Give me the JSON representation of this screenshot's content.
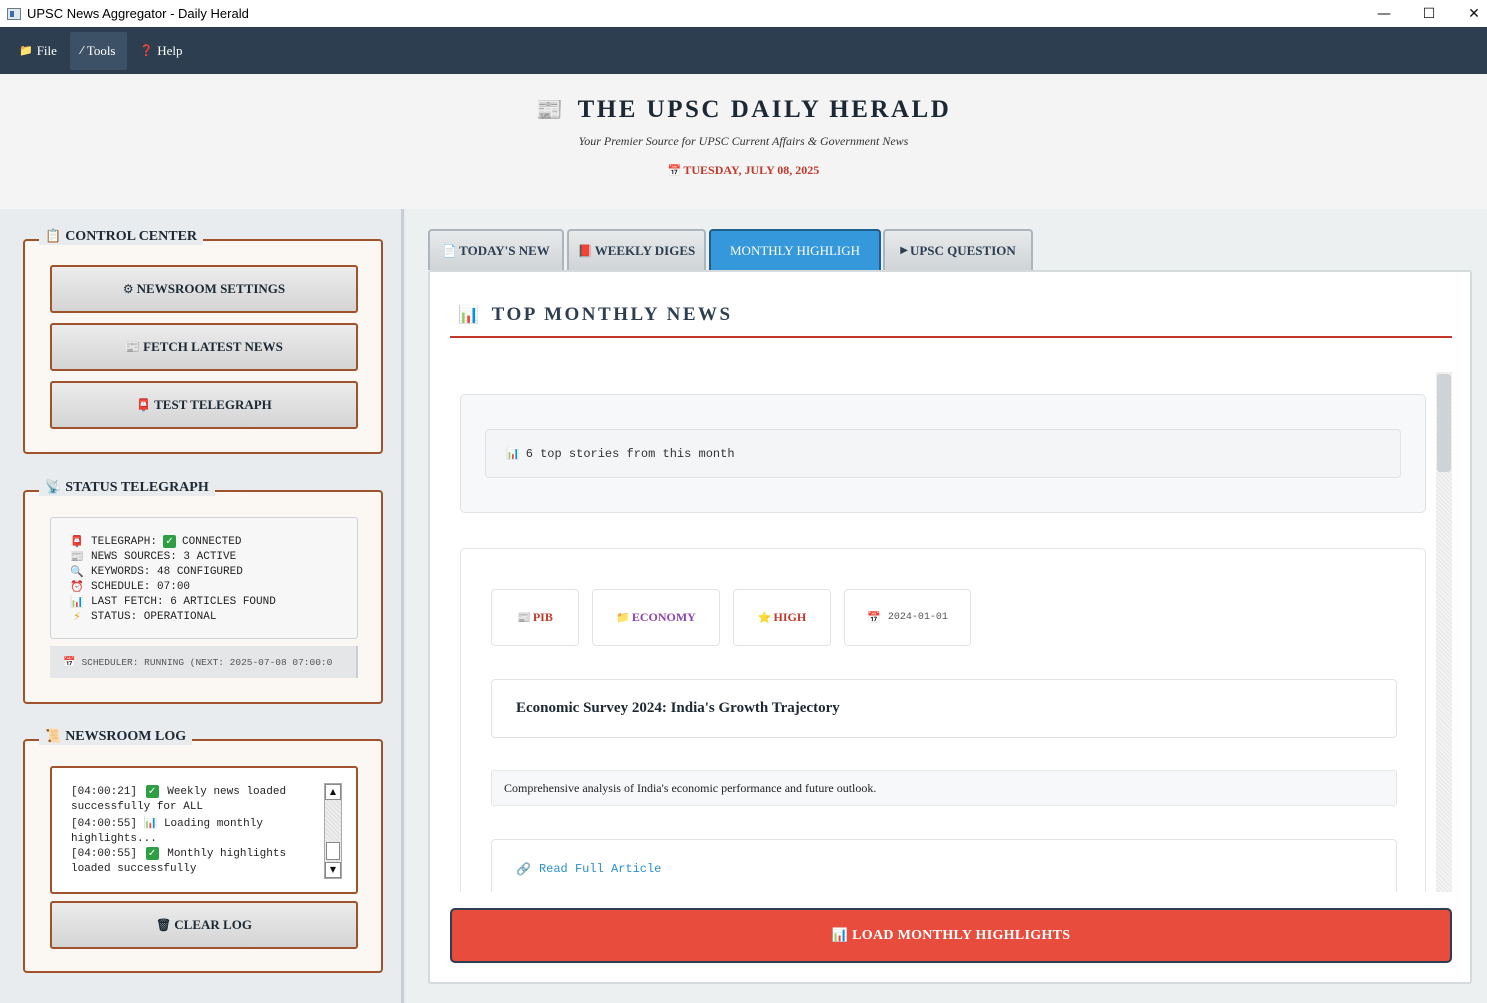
{
  "window": {
    "title": "UPSC News Aggregator - Daily Herald",
    "minimize_glyph": "—",
    "maximize_glyph": "☐",
    "close_glyph": "✕"
  },
  "menu": [
    {
      "label": "File",
      "icon": "📁"
    },
    {
      "label": "Tools",
      "icon": "⁄"
    },
    {
      "label": "Help",
      "icon": "❓"
    }
  ],
  "masthead": {
    "icon": "📰",
    "title": "THE UPSC DAILY HERALD",
    "tagline": "Your Premier Source for UPSC Current Affairs & Government News",
    "date_icon": "📅",
    "date": "TUESDAY, JULY 08, 2025"
  },
  "control_center": {
    "icon": "📋",
    "title": "CONTROL CENTER",
    "buttons": [
      {
        "icon": "⚙",
        "label": "NEWSROOM SETTINGS"
      },
      {
        "icon": "📰",
        "label": "FETCH LATEST NEWS"
      },
      {
        "icon": "📮",
        "label": "TEST TELEGRAPH"
      }
    ]
  },
  "status_telegraph": {
    "icon": "📡",
    "title": "STATUS TELEGRAPH",
    "lines": [
      {
        "icon": "📮",
        "pre": "TELEGRAPH:",
        "check": "✓",
        "post": "CONNECTED"
      },
      {
        "icon": "📰",
        "text": "NEWS SOURCES: 3 ACTIVE"
      },
      {
        "icon": "🔍",
        "text": "KEYWORDS: 48 CONFIGURED"
      },
      {
        "icon": "⏰",
        "text": "SCHEDULE: 07:00"
      },
      {
        "icon": "📊",
        "text": "LAST FETCH: 6 ARTICLES FOUND"
      },
      {
        "icon": "⚡",
        "text": "STATUS: OPERATIONAL"
      }
    ],
    "scheduler_icon": "📅",
    "scheduler": "SCHEDULER: RUNNING (NEXT: 2025-07-08 07:00:0"
  },
  "newsroom_log": {
    "icon": "📜",
    "title": "NEWSROOM LOG",
    "entries": [
      {
        "time": "[04:00:21]",
        "mark": "✓",
        "text_a": "Weekly news loaded",
        "text_b": "successfully for ALL"
      },
      {
        "time": "[04:00:55]",
        "mark": "📊",
        "text_a": "Loading monthly",
        "text_b": "highlights..."
      },
      {
        "time": "[04:00:55]",
        "mark": "✓",
        "text_a": "Monthly highlights",
        "text_b": "loaded successfully"
      }
    ],
    "clear_icon": "🗑",
    "clear_label": "CLEAR LOG",
    "scroll_up": "▲",
    "scroll_down": "▼"
  },
  "tabs": [
    {
      "icon": "📄",
      "label": "TODAY'S NEW"
    },
    {
      "icon": "📕",
      "label": "WEEKLY DIGES"
    },
    {
      "icon": "",
      "label": "MONTHLY HIGHLIGH"
    },
    {
      "icon": "▶",
      "label": "UPSC QUESTION"
    }
  ],
  "panel": {
    "heading_icon": "📊",
    "heading": "TOP MONTHLY NEWS",
    "summary_icon": "📊",
    "summary": "6 top stories from this month",
    "article": {
      "source_icon": "📰",
      "source": "PIB",
      "category_icon": "📁",
      "category": "ECONOMY",
      "priority_icon": "⭐",
      "priority": "HIGH",
      "date_icon": "📅",
      "date": "2024-01-01",
      "title": "Economic Survey 2024: India's Growth Trajectory",
      "summary": "Comprehensive analysis of India's economic performance and future outlook.",
      "link_icon": "🔗",
      "link": "Read Full Article"
    },
    "load_icon": "📊",
    "load_label": "LOAD MONTHLY HIGHLIGHTS"
  },
  "colors": {
    "menubar": "#2c3e50",
    "accent_red": "#c0392b",
    "tab_selected": "#3498db",
    "load_button": "#e74c3c",
    "frame_border": "#a0522d",
    "category_purple": "#8e44ad"
  }
}
